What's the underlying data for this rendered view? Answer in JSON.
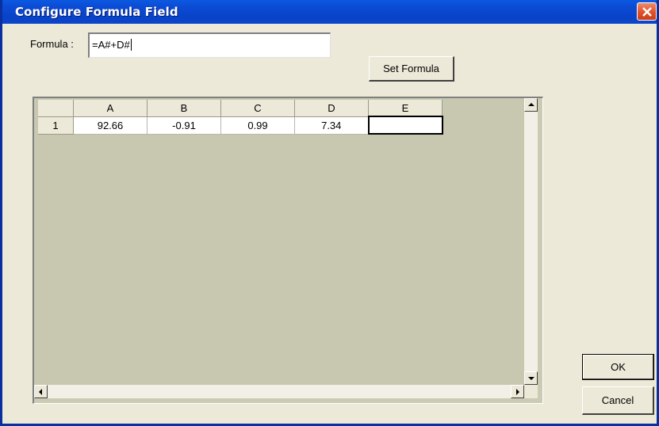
{
  "window": {
    "title": "Configure Formula Field"
  },
  "formula": {
    "label": "Formula :",
    "value": "=A#+D#"
  },
  "buttons": {
    "set_formula": "Set Formula",
    "ok": "OK",
    "cancel": "Cancel"
  },
  "grid": {
    "columns": [
      "A",
      "B",
      "C",
      "D",
      "E"
    ],
    "rows": [
      {
        "header": "1",
        "cells": [
          "92.66",
          "-0.91",
          "0.99",
          "7.34",
          ""
        ]
      }
    ]
  },
  "colors": {
    "titlebar": "#0843c8",
    "dialog_bg": "#ece9d8",
    "grid_bg": "#c8c8b0",
    "close": "#e0502a"
  },
  "icons": [
    "close-icon",
    "scroll-up-icon",
    "scroll-down-icon",
    "scroll-left-icon",
    "scroll-right-icon"
  ]
}
